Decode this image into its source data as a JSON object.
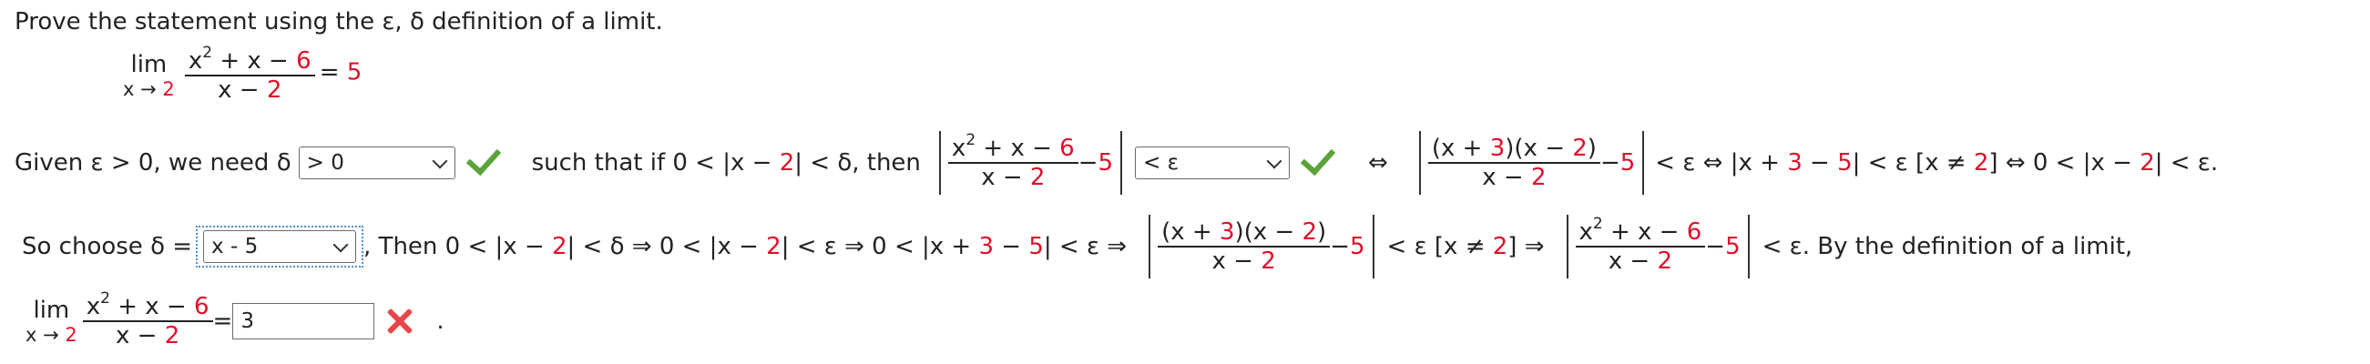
{
  "prompt": "Prove the statement using the ε, δ definition of a limit.",
  "statement": {
    "lim": "lim",
    "lim_sub_x": "x → ",
    "lim_sub_a": "2",
    "num_a": "x",
    "num_exp": "2",
    "num_b": " + x − ",
    "num_c": "6",
    "den_a": "x − ",
    "den_b": "2",
    "eq": " = ",
    "val": "5"
  },
  "row1": {
    "given": "Given  ε > 0,  we need  δ",
    "delta_select_value": "> 0",
    "such_that": "such that if  0 < |x − ",
    "two": "2",
    "then": "| < δ,  then",
    "frac_num_a": "x",
    "frac_num_exp": "2",
    "frac_num_b": " + x − ",
    "frac_num_c": "6",
    "frac_den_a": "x − ",
    "frac_den_b": "2",
    "minus": " − ",
    "five": "5",
    "eps_select_value": "< ε",
    "iff": "⇔",
    "fac_a": "(x + ",
    "fac_b": "3",
    "fac_c": ")(x − ",
    "fac_d": "2",
    "fac_e": ")",
    "tail_a": "< ε  ⇔  |x + ",
    "tail_b": "3",
    "tail_c": " − ",
    "tail_d": "5",
    "tail_e": "| < ε  [x ≠ ",
    "tail_f": "2",
    "tail_g": "]  ⇔  0 < |x − ",
    "tail_h": "2",
    "tail_i": "| < ε."
  },
  "row2": {
    "choose": "So choose  δ  =",
    "choose_select_value": "x - 5",
    "then_a": ",   Then  0 < |x − ",
    "then_b": "2",
    "then_c": "| < δ  ⇒  0 < |x − ",
    "then_d": "2",
    "then_e": "| < ε  ⇒  0 < |x + ",
    "then_f": "3",
    "then_g": " − ",
    "then_h": "5",
    "then_i": "| < ε  ⇒",
    "mid_a": "< ε  [x ≠ ",
    "mid_b": "2",
    "mid_c": "]  ⇒",
    "end": "< ε.  By the definition of a limit,"
  },
  "row3": {
    "eq": " = ",
    "answer_value": "3",
    "period": "."
  },
  "icons": {
    "correct": "check-icon",
    "incorrect": "x-mark-icon",
    "dropdown": "chevron-down-icon"
  },
  "colors": {
    "highlight": "#e0102a",
    "correct": "#5aa33a",
    "incorrect": "#e8454a",
    "focus": "#4a90d9"
  }
}
